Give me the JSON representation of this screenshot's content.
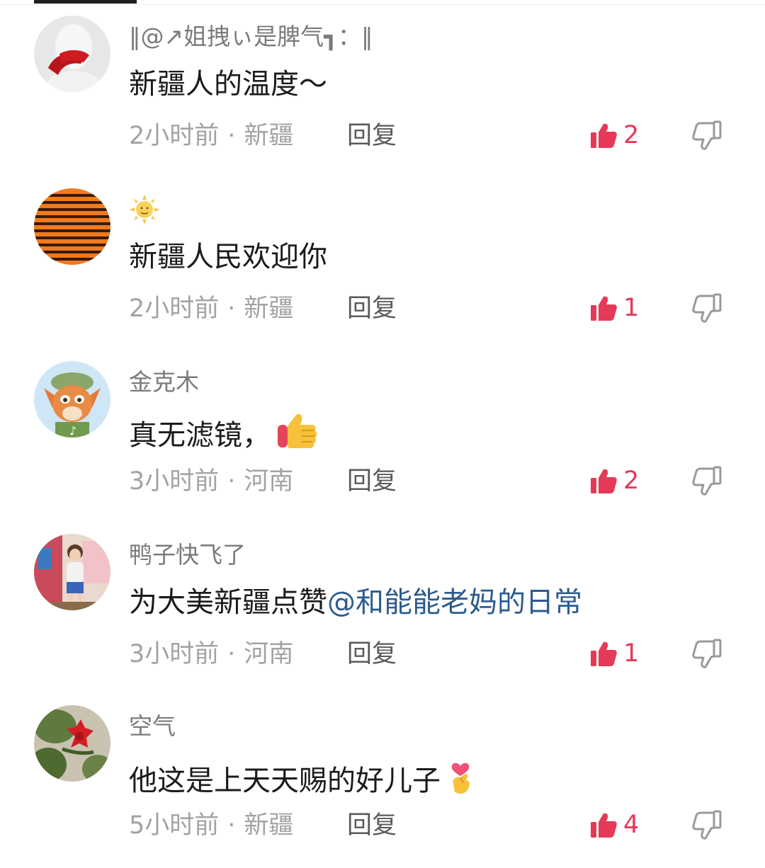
{
  "colors": {
    "accent_like": "#e43a57",
    "mention": "#2c5b8f",
    "meta_gray": "#a3a3a3"
  },
  "comments": [
    {
      "username": "‖@↗姐拽ぃ是脾气┓：‖",
      "content": "新疆人的温度～",
      "mention": "",
      "emoji": "",
      "time": "2小时前",
      "location": "新疆",
      "reply": "回复",
      "likes": "2"
    },
    {
      "username": "",
      "username_emoji": "sun-face-emoji",
      "content": "新疆人民欢迎你",
      "mention": "",
      "emoji": "",
      "time": "2小时前",
      "location": "新疆",
      "reply": "回复",
      "likes": "1"
    },
    {
      "username": "金克木",
      "content": "真无滤镜，",
      "mention": "",
      "emoji": "thumbs-up-emoji",
      "time": "3小时前",
      "location": "河南",
      "reply": "回复",
      "likes": "2"
    },
    {
      "username": "鸭子快飞了",
      "content": "为大美新疆点赞",
      "mention": "@和能能老妈的日常",
      "emoji": "",
      "time": "3小时前",
      "location": "河南",
      "reply": "回复",
      "likes": "1"
    },
    {
      "username": "空气",
      "content": "他这是上天天赐的好儿子",
      "mention": "",
      "emoji": "finger-heart-emoji",
      "time": "5小时前",
      "location": "新疆",
      "reply": "回复",
      "likes": "4"
    }
  ],
  "separator": "·"
}
